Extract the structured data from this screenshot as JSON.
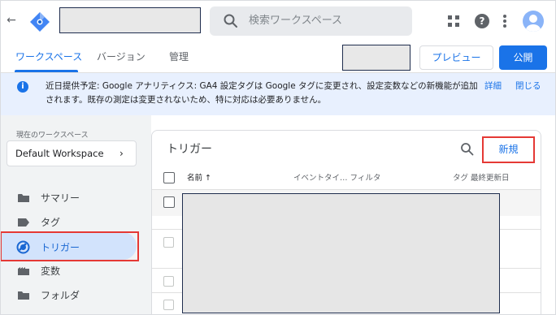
{
  "header": {
    "back_glyph": "←",
    "search_placeholder": "検索ワークスペース",
    "help_glyph": "?"
  },
  "tabs": [
    {
      "label": "ワークスペース",
      "active": true
    },
    {
      "label": "バージョン",
      "active": false
    },
    {
      "label": "管理",
      "active": false
    }
  ],
  "actions": {
    "preview_label": "プレビュー",
    "publish_label": "公開"
  },
  "notice": {
    "info_glyph": "i",
    "text": "近日提供予定: Google アナリティクス: GA4 設定タグは Google タグに変更され、設定変数などの新機能が追加されます。既存の測定は変更されないため、特に対応は必要ありません。",
    "details_label": "詳細",
    "close_label": "閉じる"
  },
  "sidebar": {
    "workspace_label": "現在のワークスペース",
    "workspace_value": "Default Workspace",
    "chevron": "›",
    "items": [
      {
        "label": "サマリー",
        "icon": "summary-icon",
        "active": false
      },
      {
        "label": "タグ",
        "icon": "tag-icon",
        "active": false
      },
      {
        "label": "トリガー",
        "icon": "trigger-icon",
        "active": true
      },
      {
        "label": "変数",
        "icon": "variable-icon",
        "active": false
      },
      {
        "label": "フォルダ",
        "icon": "folder-icon",
        "active": false
      }
    ]
  },
  "triggers": {
    "title": "トリガー",
    "new_label": "新規",
    "columns": {
      "name": "名前 ↑",
      "event_type": "イベントタイ… フィルタ",
      "tag": "タグ",
      "last_edited": "最終更新日"
    }
  },
  "colors": {
    "accent": "#1a73e8",
    "highlight": "#e53935",
    "notice_bg": "#e8f0fe",
    "active_nav_bg": "#d2e3fc"
  }
}
